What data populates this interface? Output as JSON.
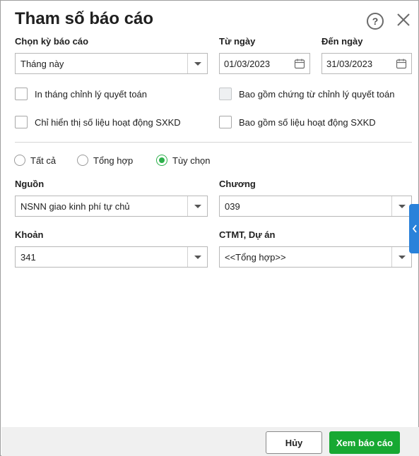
{
  "dialog": {
    "title": "Tham số báo cáo"
  },
  "period": {
    "label": "Chọn kỳ báo cáo",
    "value": "Tháng này"
  },
  "from_date": {
    "label": "Từ ngày",
    "value": "01/03/2023"
  },
  "to_date": {
    "label": "Đến ngày",
    "value": "31/03/2023"
  },
  "checkboxes": {
    "adjust_month": "In tháng chỉnh lý quyết toán",
    "include_adjust_vouchers": "Bao gồm chứng từ chỉnh lý quyết toán",
    "only_sxkd": "Chỉ hiển thị số liệu hoạt động SXKD",
    "include_sxkd": "Bao gồm số liệu hoạt động SXKD"
  },
  "radios": {
    "all": "Tất cả",
    "summary": "Tổng hợp",
    "custom": "Tùy chọn",
    "selected": "custom"
  },
  "source": {
    "label": "Nguồn",
    "value": "NSNN giao kinh phí tự chủ"
  },
  "chapter": {
    "label": "Chương",
    "value": "039"
  },
  "item": {
    "label": "Khoản",
    "value": "341"
  },
  "program": {
    "label": "CTMT, Dự án",
    "value": "<<Tổng hợp>>"
  },
  "footer": {
    "cancel_label": "Hủy",
    "view_label": "Xem báo cáo"
  },
  "colors": {
    "accent_green": "#17a832",
    "side_tab_blue": "#2a82da"
  }
}
